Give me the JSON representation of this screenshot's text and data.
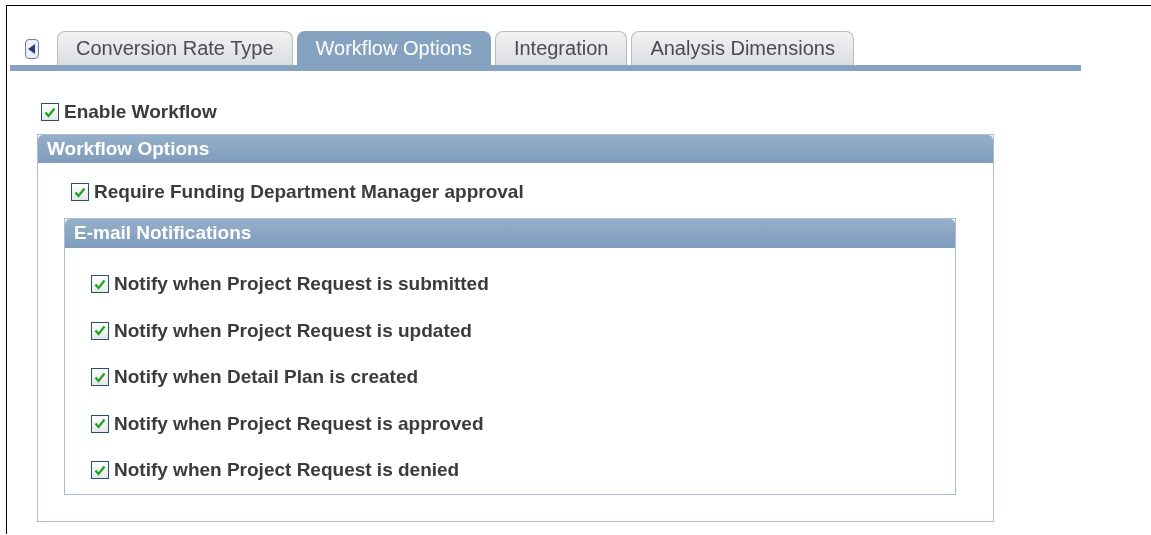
{
  "tabs": [
    {
      "label": "Conversion Rate Type",
      "selected": false
    },
    {
      "label": "Workflow Options",
      "selected": true
    },
    {
      "label": "Integration",
      "selected": false
    },
    {
      "label": "Analysis Dimensions",
      "selected": false
    }
  ],
  "enable_workflow": {
    "label": "Enable Workflow",
    "checked": true
  },
  "workflow_options": {
    "title": "Workflow Options",
    "require_approval": {
      "label": "Require Funding Department Manager approval",
      "checked": true
    },
    "email_notifications": {
      "title": "E-mail Notifications",
      "items": [
        {
          "label": "Notify when Project Request is submitted",
          "checked": true
        },
        {
          "label": "Notify when Project Request is updated",
          "checked": true
        },
        {
          "label": "Notify when Detail Plan is created",
          "checked": true
        },
        {
          "label": "Notify when Project Request is approved",
          "checked": true
        },
        {
          "label": "Notify when Project Request is denied",
          "checked": true
        }
      ]
    }
  }
}
